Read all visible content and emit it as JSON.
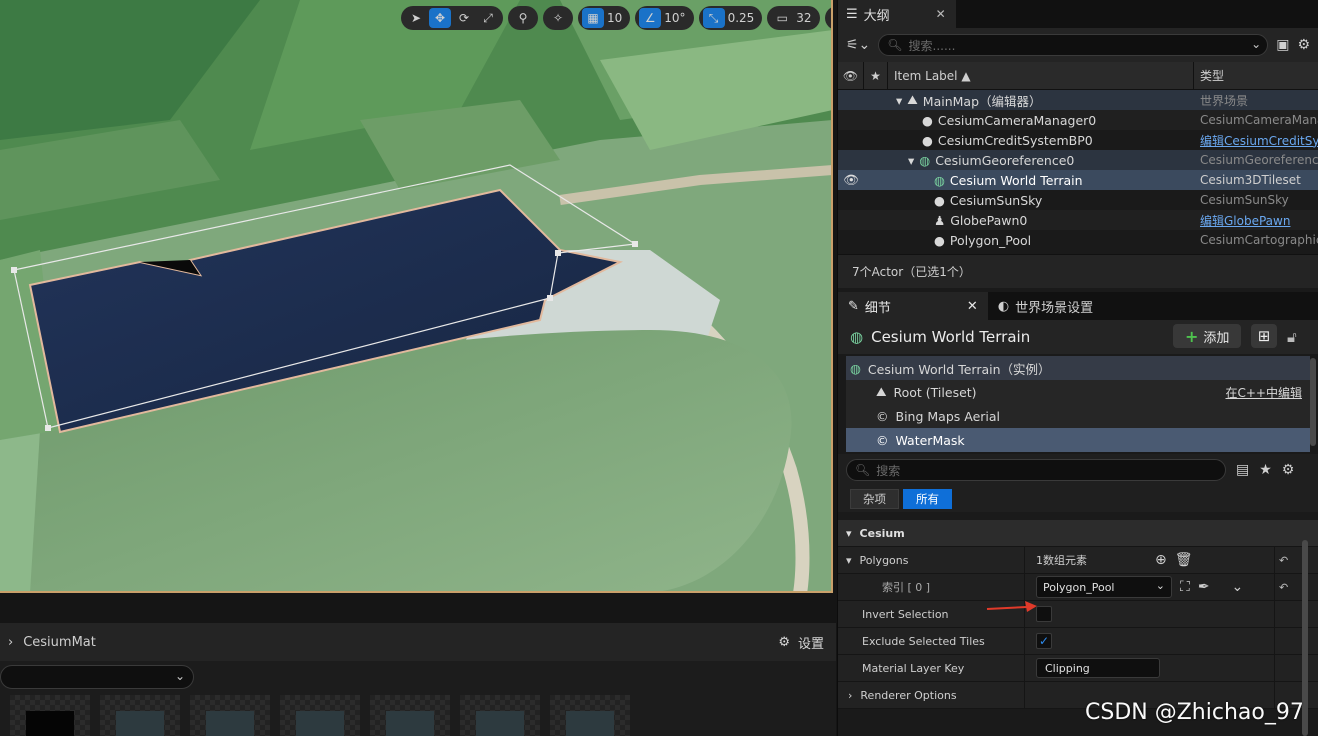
{
  "viewport_toolbar": {
    "grid_snap": "10",
    "rotation_snap": "10°",
    "scale_snap": "0.25",
    "camera_speed": "32"
  },
  "content_browser": {
    "path": "CesiumMat",
    "settings_label": "设置"
  },
  "outliner": {
    "tab_label": "大纲",
    "search_placeholder": "搜索......",
    "col_label": "Item Label ▲",
    "col_type": "类型",
    "rows": [
      {
        "label": "MainMap（编辑器）",
        "type": "世界场景",
        "icon": "map-icon"
      },
      {
        "label": "CesiumCameraManager0",
        "type": "CesiumCameraMana",
        "icon": "actor-icon"
      },
      {
        "label": "CesiumCreditSystemBP0",
        "type": "编辑CesiumCreditSy",
        "icon": "actor-icon"
      },
      {
        "label": "CesiumGeoreference0",
        "type": "CesiumGeoreference",
        "icon": "globe-icon"
      },
      {
        "label": "Cesium World Terrain",
        "type": "Cesium3DTileset",
        "icon": "globe-icon"
      },
      {
        "label": "CesiumSunSky",
        "type": "CesiumSunSky",
        "icon": "actor-icon"
      },
      {
        "label": "GlobePawn0",
        "type": "编辑GlobePawn",
        "icon": "pawn-icon"
      },
      {
        "label": "Polygon_Pool",
        "type": "CesiumCartographic",
        "icon": "actor-icon"
      }
    ],
    "actor_count": "7个Actor（已选1个）"
  },
  "details": {
    "tab_label": "细节",
    "world_settings_tab": "世界场景设置",
    "title": "Cesium World Terrain",
    "add_label": "添加",
    "components": [
      {
        "label": "Cesium World Terrain（实例）"
      },
      {
        "label": "Root (Tileset)",
        "edit": "在C++中编辑"
      },
      {
        "label": "Bing Maps Aerial"
      },
      {
        "label": "WaterMask"
      }
    ],
    "search_placeholder": "搜索",
    "filter_misc": "杂项",
    "filter_all": "所有",
    "props": {
      "cesium": "Cesium",
      "polygons": "Polygons",
      "polygons_value": "1数组元素",
      "index": "索引 [ 0 ]",
      "index_value": "Polygon_Pool",
      "invert": "Invert Selection",
      "exclude": "Exclude Selected Tiles",
      "material_key": "Material Layer Key",
      "material_value": "Clipping",
      "renderer": "Renderer Options"
    }
  },
  "watermark": "CSDN @Zhichao_97",
  "colors": {
    "accent": "#0f6fd8",
    "selection": "#3b4a5e",
    "water": "#1c2c4c"
  }
}
